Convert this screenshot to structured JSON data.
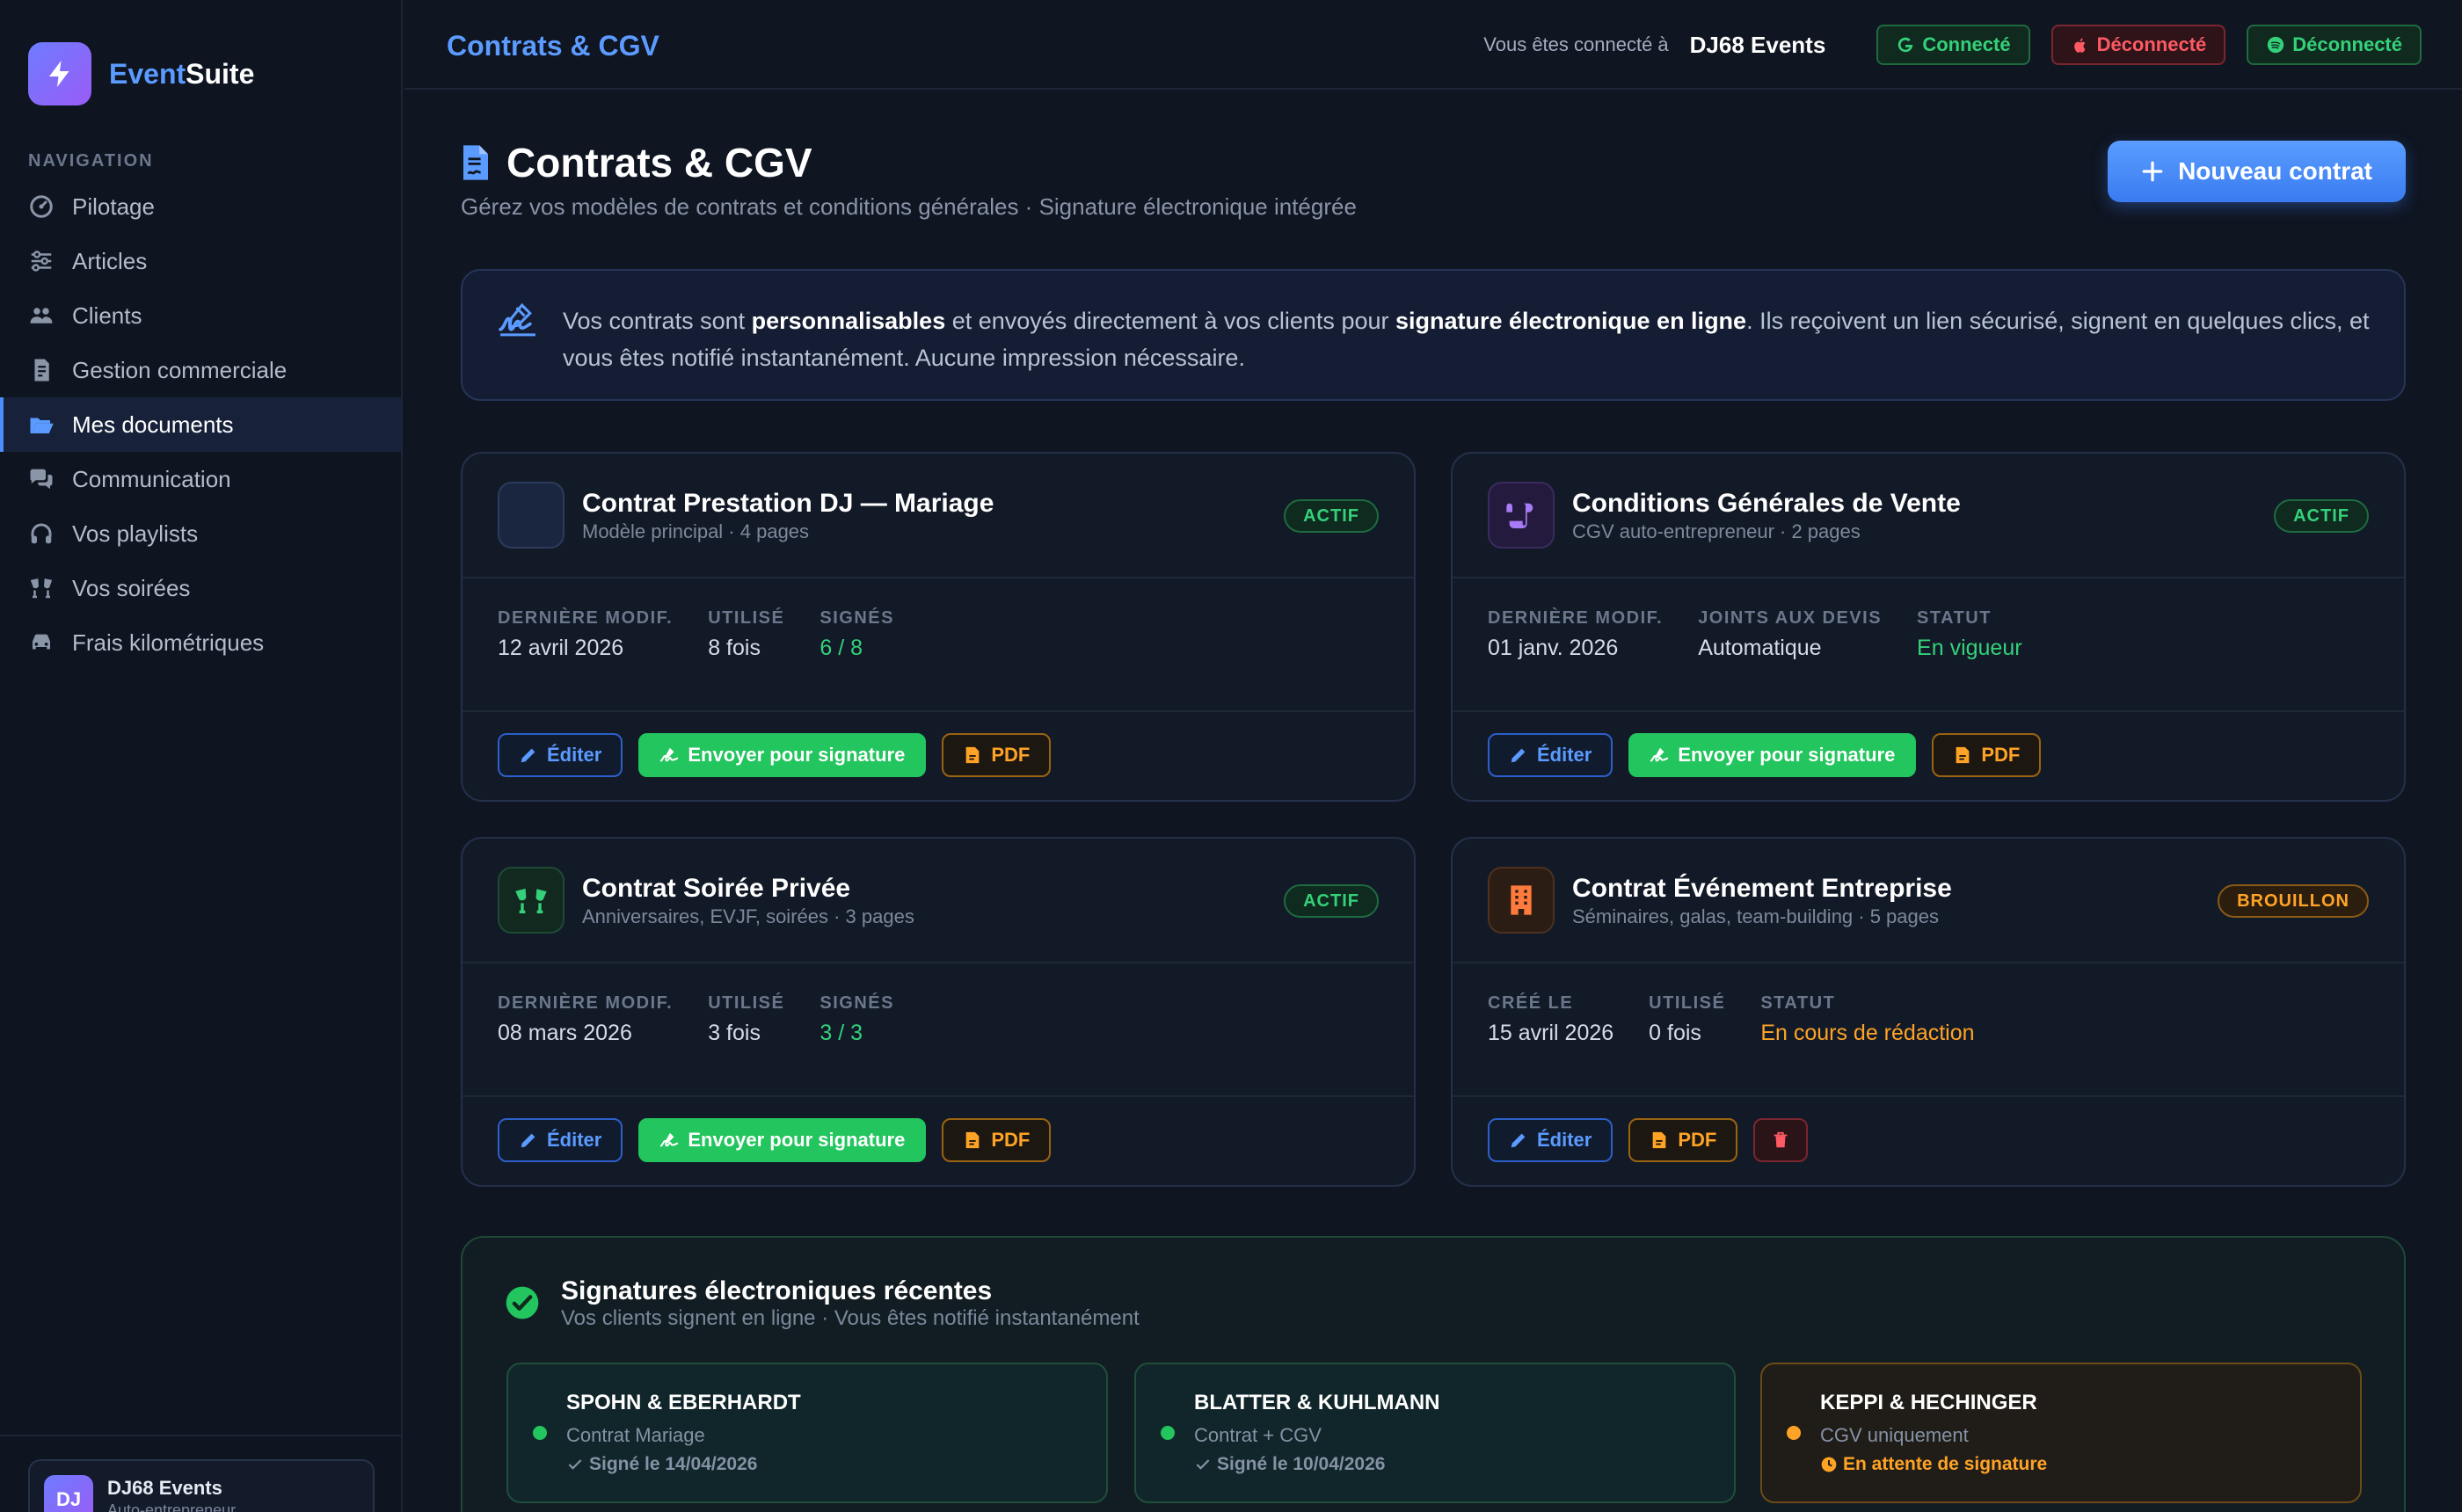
{
  "app": {
    "name_part1": "Event",
    "name_part2": "Suite",
    "accent": "#5b9bff"
  },
  "sidebar": {
    "section_title": "NAVIGATION",
    "items": [
      {
        "label": "Pilotage",
        "icon": "gauge-icon"
      },
      {
        "label": "Articles",
        "icon": "sliders-icon"
      },
      {
        "label": "Clients",
        "icon": "users-icon"
      },
      {
        "label": "Gestion commerciale",
        "icon": "invoice-icon"
      },
      {
        "label": "Mes documents",
        "icon": "folder-open-icon",
        "active": true
      },
      {
        "label": "Communication",
        "icon": "chat-icon"
      },
      {
        "label": "Vos playlists",
        "icon": "headphones-icon"
      },
      {
        "label": "Vos soirées",
        "icon": "glasses-cheers-icon"
      },
      {
        "label": "Frais kilométriques",
        "icon": "car-icon"
      }
    ],
    "user": {
      "initials": "DJ",
      "name": "DJ68 Events",
      "role": "Auto-entrepreneur"
    }
  },
  "topbar": {
    "title": "Contrats & CGV",
    "connected_text": "Vous êtes connecté à",
    "connected_name": "DJ68 Events",
    "pills": [
      {
        "label": "Connecté",
        "icon": "google-icon",
        "color": "#34d17a"
      },
      {
        "label": "Déconnecté",
        "icon": "apple-icon",
        "color": "#ff5a63"
      },
      {
        "label": "Déconnecté",
        "icon": "spotify-icon",
        "color": "#34d17a"
      }
    ]
  },
  "page": {
    "title": "Contrats & CGV",
    "subtitle": "Gérez vos modèles de contrats et conditions générales · Signature électronique intégrée",
    "new_button": "Nouveau contrat"
  },
  "info": {
    "t1": "Vos contrats sont ",
    "b1": "personnalisables",
    "t2": " et envoyés directement à vos clients pour ",
    "b2": "signature électronique en ligne",
    "t3": ". Ils reçoivent un lien sécurisé, signent en quelques clics, et vous êtes notifié instantanément. Aucune impression nécessaire."
  },
  "cards": [
    {
      "title": "Contrat Prestation DJ — Mariage",
      "subtitle": "Modèle principal · 4 pages",
      "badge": "ACTIF",
      "stats": [
        {
          "label": "DERNIÈRE MODIF.",
          "value": "12 avril 2026"
        },
        {
          "label": "UTILISÉ",
          "value": "8 fois"
        },
        {
          "label": "SIGNÉS",
          "value": "6 / 8"
        }
      ],
      "buttons": {
        "edit": "Éditer",
        "sign": "Envoyer pour signature",
        "pdf": "PDF"
      }
    },
    {
      "title": "Conditions Générales de Vente",
      "subtitle": "CGV auto-entrepreneur · 2 pages",
      "badge": "ACTIF",
      "stats": [
        {
          "label": "DERNIÈRE MODIF.",
          "value": "01 janv. 2026"
        },
        {
          "label": "JOINTS AUX DEVIS",
          "value": "Automatique"
        },
        {
          "label": "STATUT",
          "value": "En vigueur"
        }
      ],
      "buttons": {
        "edit": "Éditer",
        "sign": "Envoyer pour signature",
        "pdf": "PDF"
      }
    },
    {
      "title": "Contrat Soirée Privée",
      "subtitle": "Anniversaires, EVJF, soirées · 3 pages",
      "badge": "ACTIF",
      "stats": [
        {
          "label": "DERNIÈRE MODIF.",
          "value": "08 mars 2026"
        },
        {
          "label": "UTILISÉ",
          "value": "3 fois"
        },
        {
          "label": "SIGNÉS",
          "value": "3 / 3"
        }
      ],
      "buttons": {
        "edit": "Éditer",
        "sign": "Envoyer pour signature",
        "pdf": "PDF"
      }
    },
    {
      "title": "Contrat Événement Entreprise",
      "subtitle": "Séminaires, galas, team-building · 5 pages",
      "badge": "BROUILLON",
      "stats": [
        {
          "label": "CRÉÉ LE",
          "value": "15 avril 2026"
        },
        {
          "label": "UTILISÉ",
          "value": "0 fois"
        },
        {
          "label": "STATUT",
          "value": "En cours de rédaction"
        }
      ],
      "buttons": {
        "edit": "Éditer",
        "pdf": "PDF"
      }
    }
  ],
  "signatures": {
    "title": "Signatures électroniques récentes",
    "subtitle": "Vos clients signent en ligne · Vous êtes notifié instantanément",
    "items": [
      {
        "client": "SPOHN & EBERHARDT",
        "doc": "Contrat Mariage",
        "status": "Signé le 14/04/2026"
      },
      {
        "client": "BLATTER & KUHLMANN",
        "doc": "Contrat + CGV",
        "status": "Signé le 10/04/2026"
      },
      {
        "client": "KEPPI & HECHINGER",
        "doc": "CGV uniquement",
        "status": "En attente de signature"
      }
    ]
  },
  "colors": {
    "green": "#34d17a",
    "orange": "#ffa326",
    "red": "#ff5a63",
    "blue": "#5b9bff"
  }
}
